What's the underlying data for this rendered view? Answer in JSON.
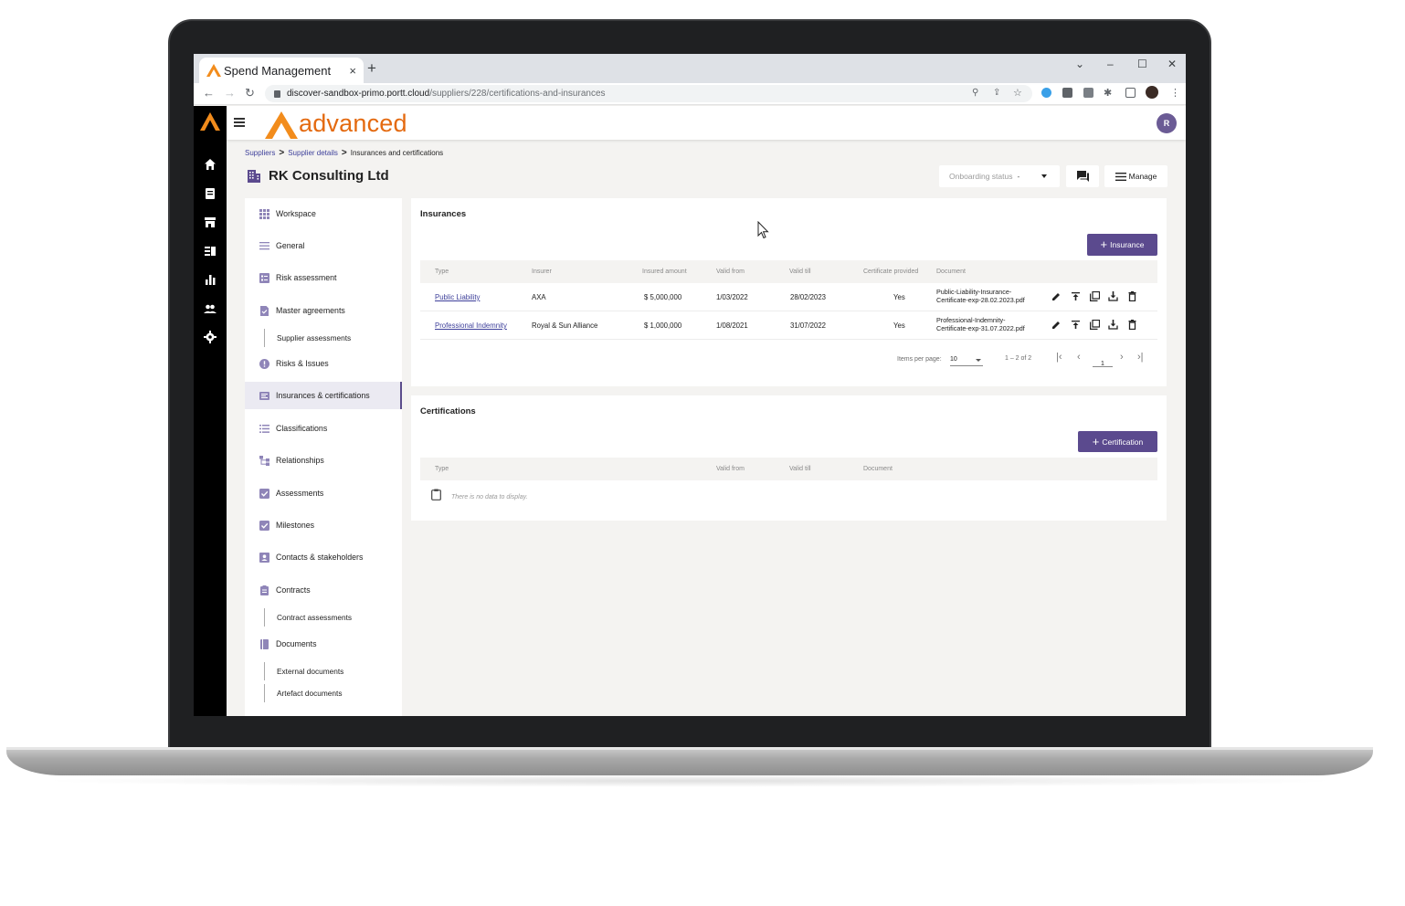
{
  "browser": {
    "tab_title": "Spend Management",
    "tab_close": "×",
    "new_tab": "+",
    "url_host": "discover-sandbox-primo.portt.cloud",
    "url_path": "/suppliers/228/certifications-and-insurances",
    "window_controls": [
      "⌄",
      "–",
      "☐",
      "✕"
    ]
  },
  "app": {
    "brand": "advanced",
    "user_initial": "R",
    "brand_color": "#e46a10",
    "accent_color": "#5b4a8e"
  },
  "breadcrumb": {
    "items": [
      "Suppliers",
      "Supplier details"
    ],
    "current": "Insurances and certifications",
    "sep": ">"
  },
  "page": {
    "title": "RK Consulting Ltd",
    "onboarding_label": "Onboarding status",
    "onboarding_value": "-",
    "manage_label": "Manage"
  },
  "sidebar": {
    "items": [
      {
        "label": "Workspace",
        "icon": "grid-icon"
      },
      {
        "label": "General",
        "icon": "lines-icon"
      },
      {
        "label": "Risk assessment",
        "icon": "risk-form-icon"
      },
      {
        "label": "Master agreements",
        "icon": "document-check-icon"
      },
      {
        "label": "Supplier assessments",
        "sub": true
      },
      {
        "label": "Risks & Issues",
        "icon": "alert-circle-icon"
      },
      {
        "label": "Insurances & certifications",
        "icon": "certificate-icon",
        "active": true
      },
      {
        "label": "Classifications",
        "icon": "list-icon"
      },
      {
        "label": "Relationships",
        "icon": "hierarchy-icon"
      },
      {
        "label": "Assessments",
        "icon": "checkbox-icon"
      },
      {
        "label": "Milestones",
        "icon": "checkbox-icon"
      },
      {
        "label": "Contacts & stakeholders",
        "icon": "contact-card-icon"
      },
      {
        "label": "Contracts",
        "icon": "clipboard-icon"
      },
      {
        "label": "Contract assessments",
        "sub": true
      },
      {
        "label": "Documents",
        "icon": "book-icon"
      },
      {
        "label": "External documents",
        "sub": true
      },
      {
        "label": "Artefact documents",
        "sub": true
      }
    ]
  },
  "insurances": {
    "title": "Insurances",
    "add_label": "Insurance",
    "columns": [
      "Type",
      "Insurer",
      "Insured amount",
      "Valid from",
      "Valid till",
      "Certificate provided",
      "Document"
    ],
    "rows": [
      {
        "type": "Public Liability",
        "insurer": "AXA",
        "amount": "$ 5,000,000",
        "from": "1/03/2022",
        "till": "28/02/2023",
        "provided": "Yes",
        "doc1": "Public-Liability-Insurance-",
        "doc2": "Certificate-exp-28.02.2023.pdf"
      },
      {
        "type": "Professional Indemnity",
        "insurer": "Royal & Sun Alliance",
        "amount": "$ 1,000,000",
        "from": "1/08/2021",
        "till": "31/07/2022",
        "provided": "Yes",
        "doc1": "Professional-Indemnity-",
        "doc2": "Certificate-exp-31.07.2022.pdf"
      }
    ],
    "pager": {
      "items_label": "Items per page:",
      "per_page": "10",
      "range": "1 – 2 of 2",
      "page": "1"
    }
  },
  "certifications": {
    "title": "Certifications",
    "add_label": "Certification",
    "columns": [
      "Type",
      "Valid from",
      "Valid till",
      "Document"
    ],
    "empty": "There is no data to display."
  }
}
